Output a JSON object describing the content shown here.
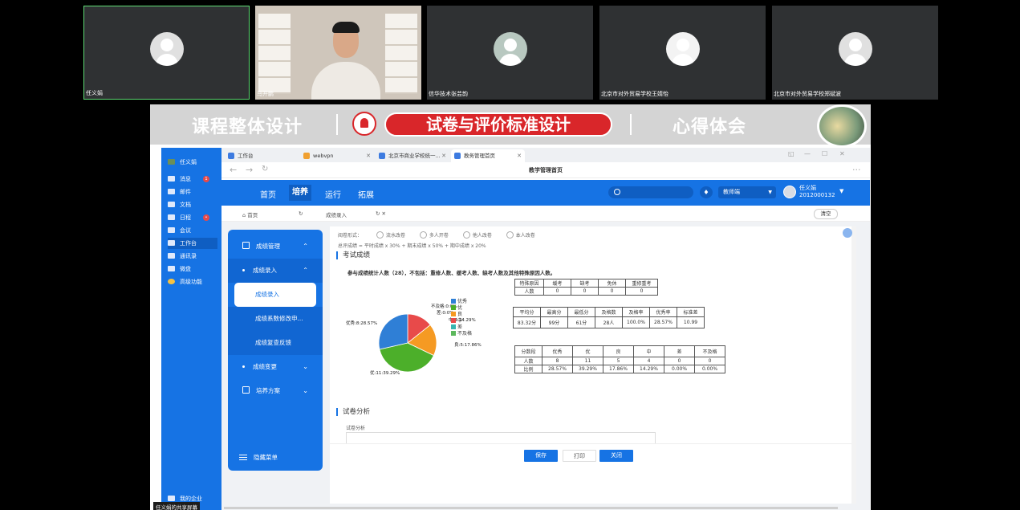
{
  "meeting": {
    "participants": [
      {
        "name": "任义娟"
      },
      {
        "name": "马开鹏"
      },
      {
        "name": "信华技术张芸韵"
      },
      {
        "name": "北京市对外贸易学校王婧怡"
      },
      {
        "name": "北京市对外贸易学校郑斌波"
      }
    ],
    "share_label": "任义娟的共享屏幕"
  },
  "banner": {
    "left": "课程整体设计",
    "active": "试卷与评价标准设计",
    "right": "心得体会"
  },
  "sidebar": {
    "user": "任义娟",
    "items": [
      {
        "label": "消息",
        "badge": "1"
      },
      {
        "label": "邮件",
        "badge": ""
      },
      {
        "label": "文档",
        "badge": ""
      },
      {
        "label": "日程",
        "badge": "•"
      },
      {
        "label": "会议",
        "badge": ""
      },
      {
        "label": "工作台",
        "badge": ""
      },
      {
        "label": "通讯录",
        "badge": ""
      },
      {
        "label": "微盘",
        "badge": ""
      },
      {
        "label": "高级功能",
        "badge": ""
      }
    ],
    "bottom": "我的企业"
  },
  "browser": {
    "tabs": [
      {
        "label": "工作台",
        "color": "#3d7be0"
      },
      {
        "label": "webvpn",
        "color": "#f0a030"
      },
      {
        "label": "北京市商业学校统一...",
        "color": "#3d7be0"
      },
      {
        "label": "教务管理首页",
        "color": "#3d7be0"
      }
    ],
    "page_title": "教学管理首页"
  },
  "app": {
    "nav": [
      "首页",
      "培养",
      "运行",
      "拓展"
    ],
    "active_nav": "培养",
    "role": "教师端",
    "user_name": "任义娟",
    "user_id": "2012000132",
    "crumb_home": "首页",
    "crumb_current": "成绩录入",
    "clear_label": "清空"
  },
  "left_menu": {
    "group1": "成绩管理",
    "group1_sub": "成绩录入",
    "items": [
      "成绩录入",
      "成绩系数修改申...",
      "成绩复查反馈"
    ],
    "group2": "成绩变更",
    "group3": "培养方案",
    "hide": "隐藏菜单"
  },
  "form": {
    "method_label": "阅卷形式：",
    "methods": [
      "流水改卷",
      "多人开卷",
      "他人改卷",
      "本人改卷"
    ],
    "formula": "总评成绩 = 平时成绩 x 30% + 期末成绩 x 50% + 期中成绩 x 20%",
    "section1": "考试成绩",
    "count_note": "参与成绩统计人数（28），不包括：重修人数、缓考人数、缺考人数及其他特殊原因人数。",
    "section2": "试卷分析",
    "analysis_label": "试卷分析",
    "buttons": [
      "保存",
      "打印",
      "关闭"
    ]
  },
  "table_special": {
    "headers": [
      "特殊原因",
      "缓考",
      "缺考",
      "免休",
      "重修重考"
    ],
    "row": [
      "人数",
      "0",
      "0",
      "0",
      "0"
    ]
  },
  "table_stats": {
    "headers": [
      "平均分",
      "最高分",
      "最低分",
      "及格数",
      "及格率",
      "优秀率",
      "标准差"
    ],
    "row": [
      "83.32分",
      "99分",
      "61分",
      "28人",
      "100.0%",
      "28.57%",
      "10.99"
    ]
  },
  "table_dist": {
    "headers": [
      "分数段",
      "优秀",
      "优",
      "良",
      "中",
      "差",
      "不及格"
    ],
    "rows": [
      [
        "人数",
        "8",
        "11",
        "5",
        "4",
        "0",
        "0"
      ],
      [
        "比例",
        "28.57%",
        "39.29%",
        "17.86%",
        "14.29%",
        "0.00%",
        "0.00%"
      ]
    ]
  },
  "chart_data": {
    "type": "pie",
    "categories": [
      "优秀",
      "优",
      "良",
      "中",
      "差",
      "不及格"
    ],
    "values": [
      8,
      11,
      5,
      4,
      0,
      0
    ],
    "percent": [
      28.57,
      39.29,
      17.86,
      14.29,
      0,
      0
    ],
    "colors": [
      "#2f7fd6",
      "#4caf2a",
      "#f59a23",
      "#e84a4a",
      "#36b5b0",
      "#5cb85c"
    ],
    "labels": [
      "优秀:8:28.57%",
      "优:11:39.29%",
      "良:5:17.86%",
      "中:4:14.29%",
      "差:0:0%",
      "不及格:0:0%"
    ],
    "legend": "right"
  }
}
